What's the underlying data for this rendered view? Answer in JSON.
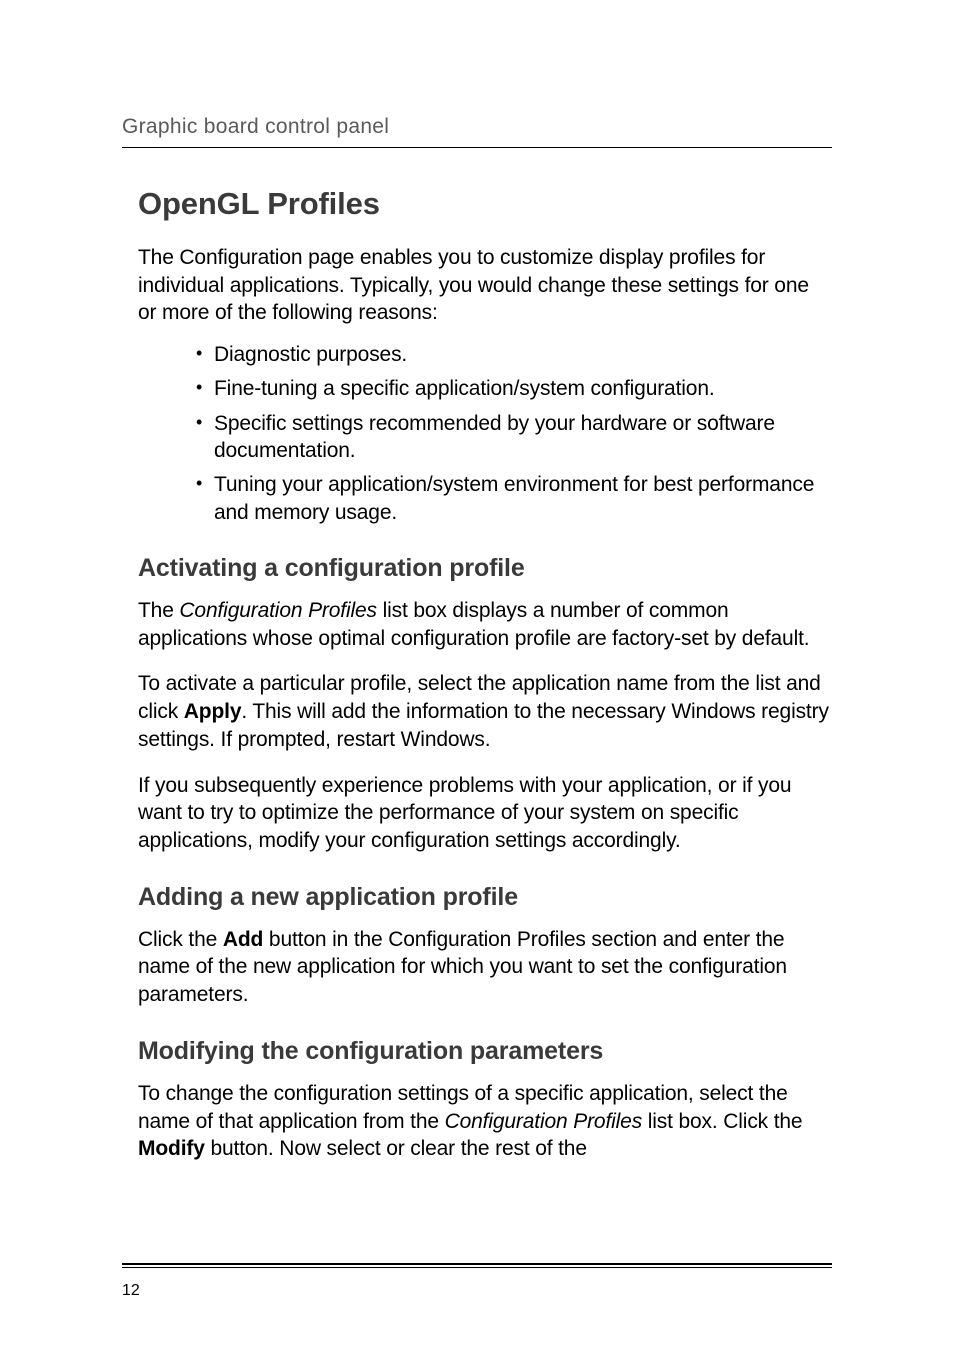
{
  "header": {
    "running_title": "Graphic board control panel"
  },
  "title": "OpenGL Profiles",
  "intro": "The Configuration page enables you to customize display profiles for individual applications. Typically, you would change these settings for one or more of the following reasons:",
  "bullets": [
    "Diagnostic purposes.",
    "Fine-tuning a specific application/system configuration.",
    "Specific settings recommended by your hardware or software documentation.",
    "Tuning your application/system environment for best performance and memory usage."
  ],
  "sections": [
    {
      "heading": "Activating a configuration profile",
      "paragraphs": [
        {
          "parts": [
            {
              "t": "The "
            },
            {
              "t": "Configuration Profiles",
              "style": "italic"
            },
            {
              "t": " list box displays a number of common applications whose optimal configuration profile are factory-set by default."
            }
          ]
        },
        {
          "parts": [
            {
              "t": "To activate a particular profile, select the application name from the list and click "
            },
            {
              "t": "Apply",
              "style": "bold"
            },
            {
              "t": ". This will add the information to the necessary Windows registry settings. If prompted, restart Windows."
            }
          ]
        },
        {
          "parts": [
            {
              "t": "If you subsequently experience problems with your application, or if you want to try to optimize the performance of your system on specific applications, modify your configuration settings accordingly."
            }
          ]
        }
      ]
    },
    {
      "heading": "Adding a new application profile",
      "paragraphs": [
        {
          "parts": [
            {
              "t": "Click the "
            },
            {
              "t": "Add",
              "style": "bold"
            },
            {
              "t": " button in the Configuration Profiles section and enter the name of the new application for which you want to set the configuration parameters."
            }
          ]
        }
      ]
    },
    {
      "heading": "Modifying the configuration parameters",
      "paragraphs": [
        {
          "parts": [
            {
              "t": "To change the configuration settings of a specific application, select the name of that application from the "
            },
            {
              "t": "Configuration Profiles",
              "style": "italic"
            },
            {
              "t": " list box. Click the "
            },
            {
              "t": "Modify",
              "style": "bold"
            },
            {
              "t": " button. Now select or clear the rest of the"
            }
          ]
        }
      ]
    }
  ],
  "footer": {
    "page_number": "12"
  }
}
